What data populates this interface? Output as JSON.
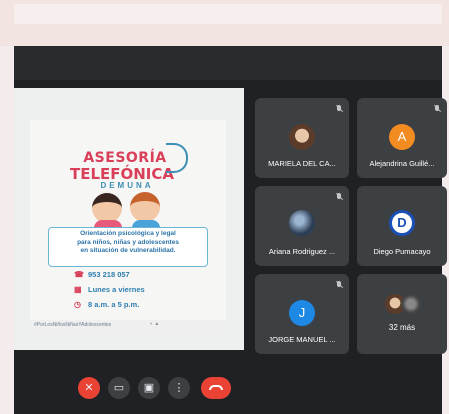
{
  "poster": {
    "title_line1": "ASESORÍA",
    "title_line2": "TELEFÓNICA",
    "title_line3": "DEMUNA",
    "description": [
      "Orientación psicológica y legal",
      "para niños, niñas y adolescentes",
      "en situación de vulnerabilidad."
    ],
    "phone": "953 218 057",
    "days": "Lunes a viernes",
    "hours": "8 a.m. a 5 p.m.",
    "hashtag": "#PorLosNiñosNiñasYAdolescentes",
    "colors": {
      "red": "#d93f58",
      "blue": "#2f7fb0"
    }
  },
  "participants": [
    {
      "name": "MARIELA DEL CA...",
      "avatar": "photo",
      "muted": true
    },
    {
      "name": "Alejandrina Guillé...",
      "avatar_letter": "A",
      "avatar_color": "#f28b20",
      "muted": true
    },
    {
      "name": "Ariana Rodriguez ...",
      "avatar": "photo",
      "muted": true
    },
    {
      "name": "Diego Pumacayo",
      "avatar_letter": "D",
      "avatar_color": "#1a4fb5",
      "muted": false
    },
    {
      "name": "JORGE MANUEL ...",
      "avatar_letter": "J",
      "avatar_color": "#1e88e5",
      "muted": true
    }
  ],
  "more": {
    "label": "32 más"
  },
  "controls": [
    "mic-off-icon",
    "camera-icon",
    "present-icon",
    "more-vert-icon",
    "hang-up-icon"
  ]
}
